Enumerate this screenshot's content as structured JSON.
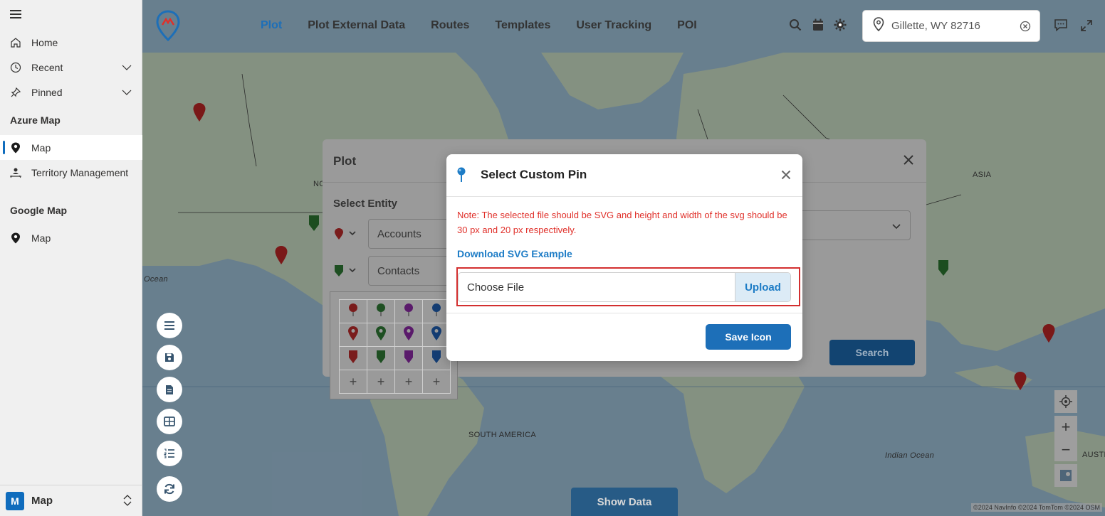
{
  "sidebar": {
    "items": [
      {
        "label": "Home",
        "icon": "home-icon"
      },
      {
        "label": "Recent",
        "icon": "clock-icon"
      },
      {
        "label": "Pinned",
        "icon": "pin-icon"
      }
    ],
    "groups": [
      {
        "label": "Azure Map",
        "items": [
          {
            "label": "Map",
            "icon": "map-pin-icon",
            "selected": true
          },
          {
            "label": "Territory Management",
            "icon": "territory-icon"
          }
        ]
      },
      {
        "label": "Google Map",
        "items": [
          {
            "label": "Map",
            "icon": "map-pin-icon"
          }
        ]
      }
    ],
    "footer": {
      "badge": "M",
      "label": "Map"
    }
  },
  "topbar": {
    "tabs": [
      "Plot",
      "Plot External Data",
      "Routes",
      "Templates",
      "User Tracking",
      "POI"
    ],
    "active_tab": "Plot",
    "location": "Gillette, WY 82716"
  },
  "map": {
    "labels": {
      "asia": "ASIA",
      "north": "NO",
      "ocean": "Ocean",
      "south_america": "SOUTH AMERICA",
      "indian_ocean": "Indian Ocean",
      "austr": "AUSTR"
    },
    "copyright": "©2024 NavInfo ©2024 TomTom ©2024 OSM",
    "show_data_label": "Show Data",
    "zoom_in": "+",
    "zoom_out": "−"
  },
  "plot_dialog": {
    "title": "Plot",
    "select_entity_label": "Select Entity",
    "entities": [
      {
        "value": "Accounts",
        "pin_color": "#c62828"
      },
      {
        "value": "Contacts",
        "pin_color": "#2e7d32"
      }
    ],
    "search_label": "Search"
  },
  "pin_grid": {
    "colors": [
      "#c62828",
      "#2e7d32",
      "#8e24aa",
      "#1e5fb4"
    ],
    "add_symbol": "+"
  },
  "modal": {
    "title": "Select Custom Pin",
    "note": "Note: The selected file should be SVG and height and width of the svg should be 30 px and 20 px respectively.",
    "download_link": "Download SVG Example",
    "file_input_label": "Choose File",
    "upload_label": "Upload",
    "save_label": "Save Icon"
  },
  "colors": {
    "accent": "#1d6fb8",
    "note_red": "#e0302a",
    "highlight_red": "#d32f2f",
    "ocean": "#a9cde6",
    "land": "#d6ead0"
  }
}
